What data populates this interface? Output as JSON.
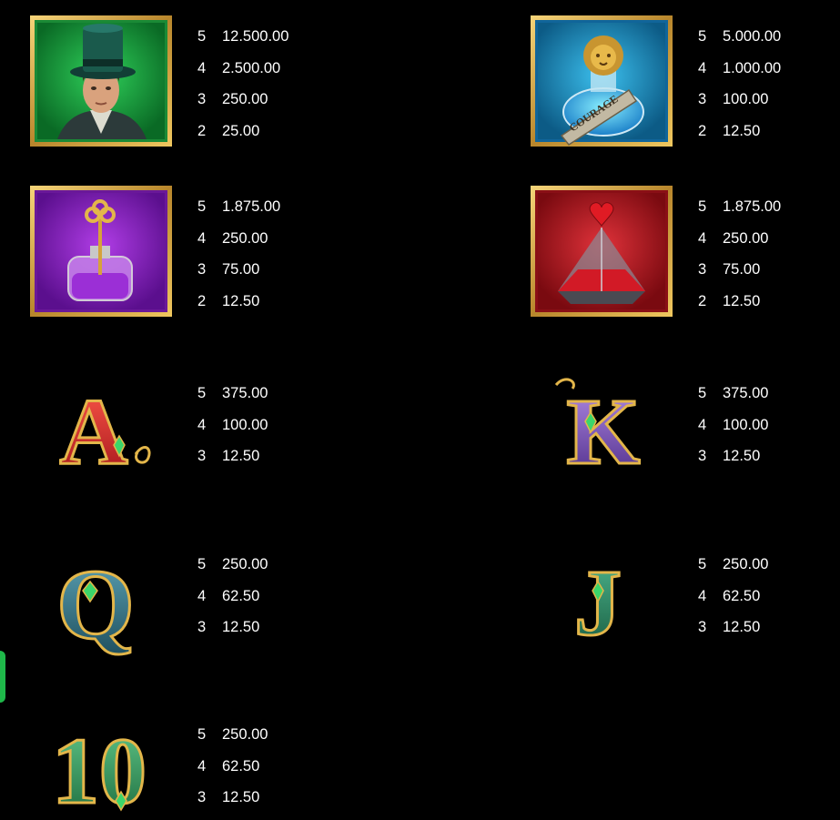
{
  "accent_tab_color": "#1fb84a",
  "symbols": [
    {
      "name": "Gentleman in green top hat",
      "icon": "top-hat-man-icon",
      "frame_color": "#1fae3a",
      "payouts": [
        {
          "count": "5",
          "value": "12.500.00"
        },
        {
          "count": "4",
          "value": "2.500.00"
        },
        {
          "count": "3",
          "value": "250.00"
        },
        {
          "count": "2",
          "value": "25.00"
        }
      ]
    },
    {
      "name": "Courage lion potion",
      "icon": "lion-potion-icon",
      "frame_color": "#1a8fc4",
      "label_text": "COURAGE",
      "payouts": [
        {
          "count": "5",
          "value": "5.000.00"
        },
        {
          "count": "4",
          "value": "1.000.00"
        },
        {
          "count": "3",
          "value": "100.00"
        },
        {
          "count": "2",
          "value": "12.50"
        }
      ]
    },
    {
      "name": "Purple key bottle",
      "icon": "key-bottle-icon",
      "frame_color": "#8a1ec0",
      "payouts": [
        {
          "count": "5",
          "value": "1.875.00"
        },
        {
          "count": "4",
          "value": "250.00"
        },
        {
          "count": "3",
          "value": "75.00"
        },
        {
          "count": "2",
          "value": "12.50"
        }
      ]
    },
    {
      "name": "Red heart pyramid",
      "icon": "heart-pyramid-icon",
      "frame_color": "#b5121b",
      "payouts": [
        {
          "count": "5",
          "value": "1.875.00"
        },
        {
          "count": "4",
          "value": "250.00"
        },
        {
          "count": "3",
          "value": "75.00"
        },
        {
          "count": "2",
          "value": "12.50"
        }
      ]
    },
    {
      "name": "Letter A",
      "icon": "letter-a-icon",
      "glyph": "A",
      "payouts": [
        {
          "count": "5",
          "value": "375.00"
        },
        {
          "count": "4",
          "value": "100.00"
        },
        {
          "count": "3",
          "value": "12.50"
        }
      ]
    },
    {
      "name": "Letter K",
      "icon": "letter-k-icon",
      "glyph": "K",
      "payouts": [
        {
          "count": "5",
          "value": "375.00"
        },
        {
          "count": "4",
          "value": "100.00"
        },
        {
          "count": "3",
          "value": "12.50"
        }
      ]
    },
    {
      "name": "Letter Q",
      "icon": "letter-q-icon",
      "glyph": "Q",
      "payouts": [
        {
          "count": "5",
          "value": "250.00"
        },
        {
          "count": "4",
          "value": "62.50"
        },
        {
          "count": "3",
          "value": "12.50"
        }
      ]
    },
    {
      "name": "Letter J",
      "icon": "letter-j-icon",
      "glyph": "J",
      "payouts": [
        {
          "count": "5",
          "value": "250.00"
        },
        {
          "count": "4",
          "value": "62.50"
        },
        {
          "count": "3",
          "value": "12.50"
        }
      ]
    },
    {
      "name": "Number 10",
      "icon": "number-10-icon",
      "glyph": "10",
      "payouts": [
        {
          "count": "5",
          "value": "250.00"
        },
        {
          "count": "4",
          "value": "62.50"
        },
        {
          "count": "3",
          "value": "12.50"
        }
      ]
    }
  ]
}
